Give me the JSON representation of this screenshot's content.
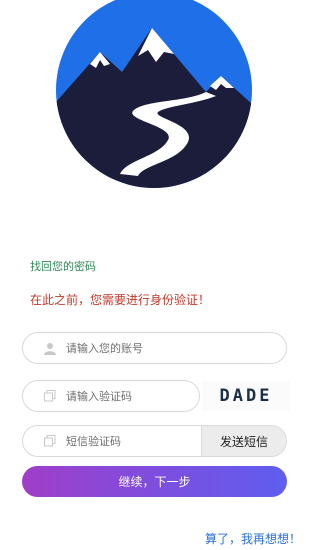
{
  "logo": {
    "name": "mountain-road-logo",
    "ring_color": "#1f6fe8",
    "inner_color": "#1b1d3a"
  },
  "find_title": "找回您的密码",
  "notice": "在此之前，您需要进行身份验证！",
  "account": {
    "placeholder": "请输入您的账号",
    "icon": "user-icon"
  },
  "captcha": {
    "placeholder": "请输入验证码",
    "icon": "copy-icon",
    "image_text": "DADE"
  },
  "sms": {
    "placeholder": "短信验证码",
    "icon": "copy-icon",
    "send_label": "发送短信"
  },
  "next_label": "继续，下一步",
  "later_label": "算了，我再想想！"
}
